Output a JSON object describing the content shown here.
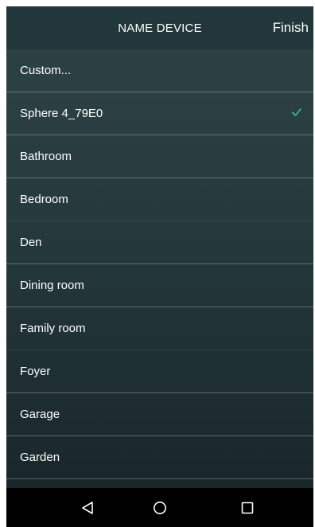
{
  "header": {
    "title": "NAME DEVICE",
    "finish_label": "Finish"
  },
  "list": {
    "items": [
      {
        "label": "Custom...",
        "selected": false
      },
      {
        "label": "Sphere 4_79E0",
        "selected": true
      },
      {
        "label": "Bathroom",
        "selected": false
      },
      {
        "label": "Bedroom",
        "selected": false
      },
      {
        "label": "Den",
        "selected": false
      },
      {
        "label": "Dining room",
        "selected": false
      },
      {
        "label": "Family room",
        "selected": false
      },
      {
        "label": "Foyer",
        "selected": false
      },
      {
        "label": "Garage",
        "selected": false
      },
      {
        "label": "Garden",
        "selected": false
      }
    ]
  },
  "navbar": {
    "icons": [
      "back-icon",
      "home-icon",
      "recents-icon"
    ]
  },
  "colors": {
    "accent_check": "#3fbf8f",
    "background_top": "#2f4447",
    "background_bottom": "#172428",
    "navbar": "#000000",
    "text": "#ffffff"
  }
}
